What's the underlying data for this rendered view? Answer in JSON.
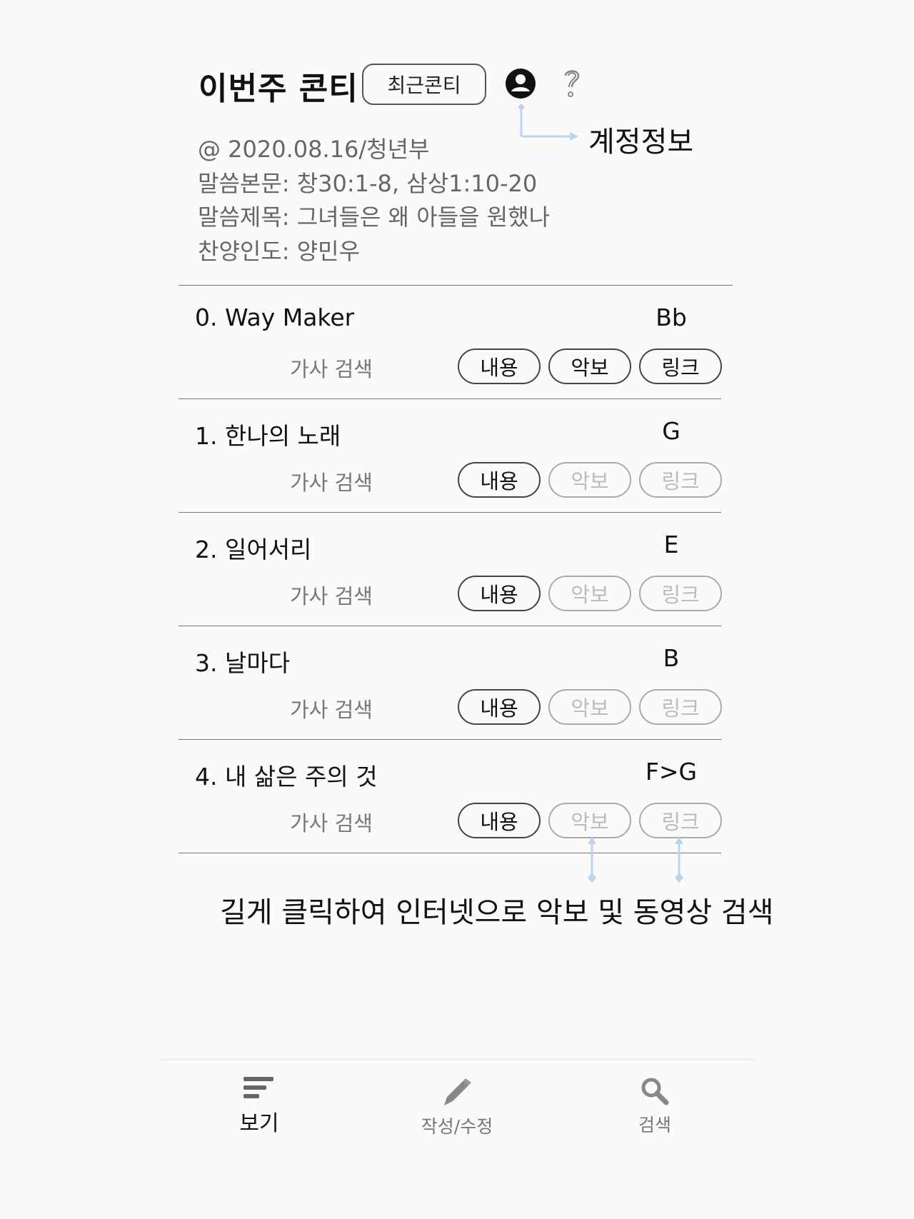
{
  "header": {
    "title": "이번주 콘티",
    "recent_button": "최근콘티"
  },
  "info": {
    "date_group": "@ 2020.08.16/청년부",
    "scripture": "말씀본문: 창30:1-8, 삼상1:10-20",
    "sermon_title": "말씀제목: 그녀들은 왜 아들을 원했나",
    "leader": "찬양인도: 양민우"
  },
  "annotations": {
    "account": "계정정보",
    "long_press": "길게 클릭하여 인터넷으로 악보 및 동영상 검색"
  },
  "songs": [
    {
      "title": "0.  Way Maker",
      "key": "Bb",
      "lyrics": "가사 검색",
      "content": "내용",
      "sheet": "악보",
      "link": "링크",
      "sheet_enabled": true,
      "link_enabled": true
    },
    {
      "title": "1.  한나의 노래",
      "key": "G",
      "lyrics": "가사 검색",
      "content": "내용",
      "sheet": "악보",
      "link": "링크",
      "sheet_enabled": false,
      "link_enabled": false
    },
    {
      "title": "2.  일어서리",
      "key": "E",
      "lyrics": "가사 검색",
      "content": "내용",
      "sheet": "악보",
      "link": "링크",
      "sheet_enabled": false,
      "link_enabled": false
    },
    {
      "title": "3.  날마다",
      "key": "B",
      "lyrics": "가사 검색",
      "content": "내용",
      "sheet": "악보",
      "link": "링크",
      "sheet_enabled": false,
      "link_enabled": false
    },
    {
      "title": "4.  내 삶은 주의 것",
      "key": "F>G",
      "lyrics": "가사 검색",
      "content": "내용",
      "sheet": "악보",
      "link": "링크",
      "sheet_enabled": false,
      "link_enabled": false
    }
  ],
  "nav": {
    "view": "보기",
    "edit": "작성/수정",
    "search": "검색"
  },
  "colors": {
    "annotation_arrow": "#b9d4ee",
    "disabled_text": "#bbbbbb"
  }
}
